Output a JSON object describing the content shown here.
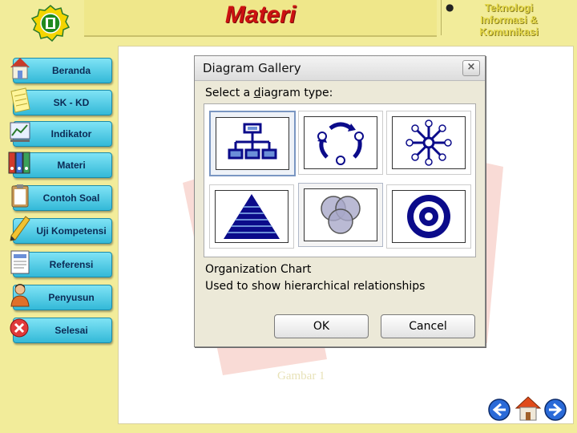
{
  "header": {
    "title": "Materi",
    "course_title": "Teknologi\nInformasi &\nKomunikasi"
  },
  "sidebar": {
    "items": [
      {
        "label": "Beranda",
        "icon": "house-icon"
      },
      {
        "label": "SK - KD",
        "icon": "notepad-icon"
      },
      {
        "label": "Indikator",
        "icon": "chart-icon"
      },
      {
        "label": "Materi",
        "icon": "binders-icon"
      },
      {
        "label": "Contoh Soal",
        "icon": "clipboard-icon"
      },
      {
        "label": "Uji Kompetensi",
        "icon": "pencil-icon"
      },
      {
        "label": "Referensi",
        "icon": "document-icon"
      },
      {
        "label": "Penyusun",
        "icon": "person-icon"
      },
      {
        "label": "Selesai",
        "icon": "exit-icon"
      }
    ]
  },
  "dialog": {
    "title": "Diagram Gallery",
    "close_label": "×",
    "prompt_before": "Select a ",
    "prompt_hotkey": "d",
    "prompt_after": "iagram type:",
    "diagram_types": [
      {
        "icon": "organization-chart-icon"
      },
      {
        "icon": "cycle-diagram-icon"
      },
      {
        "icon": "radial-diagram-icon"
      },
      {
        "icon": "pyramid-diagram-icon"
      },
      {
        "icon": "venn-diagram-icon"
      },
      {
        "icon": "target-diagram-icon"
      }
    ],
    "selected_name": "Organization Chart",
    "selected_description": "Used to show hierarchical relationships",
    "ok_label": "OK",
    "cancel_label": "Cancel"
  },
  "caption": "Gambar 1",
  "colors": {
    "page_background": "#f2ec9a",
    "title_red": "#cc1111",
    "nav_button": "#33b9d8",
    "diagram_blue": "#0b0b8a"
  }
}
